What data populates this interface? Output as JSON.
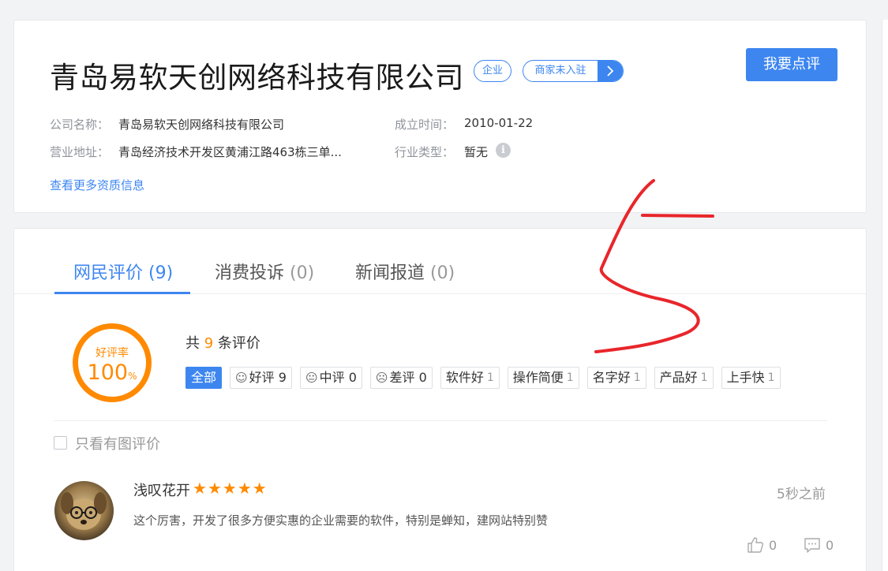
{
  "company": {
    "name": "青岛易软天创网络科技有限公司",
    "tag_enterprise": "企业",
    "tag_merchant": "商家未入驻",
    "review_button": "我要点评",
    "fields": {
      "name_label": "公司名称：",
      "name_value": "青岛易软天创网络科技有限公司",
      "founded_label": "成立时间：",
      "founded_value": "2010-01-22",
      "address_label": "营业地址：",
      "address_value": "青岛经济技术开发区黄浦江路463栋三单...",
      "industry_label": "行业类型：",
      "industry_value": "暂无"
    },
    "more_link": "查看更多资质信息"
  },
  "tabs": [
    {
      "label": "网民评价",
      "count": "(9)"
    },
    {
      "label": "消费投诉",
      "count": "(0)"
    },
    {
      "label": "新闻报道",
      "count": "(0)"
    }
  ],
  "summary": {
    "ring_label": "好评率",
    "ring_value": "100",
    "ring_unit": "%",
    "total_prefix": "共",
    "total_count": "9",
    "total_suffix": "条评价"
  },
  "filters": {
    "all": "全部",
    "good": {
      "label": "好评",
      "count": "9"
    },
    "neutral": {
      "label": "中评",
      "count": "0"
    },
    "bad": {
      "label": "差评",
      "count": "0"
    },
    "tags": [
      {
        "label": "软件好",
        "count": "1"
      },
      {
        "label": "操作简便",
        "count": "1"
      },
      {
        "label": "名字好",
        "count": "1"
      },
      {
        "label": "产品好",
        "count": "1"
      },
      {
        "label": "上手快",
        "count": "1"
      }
    ]
  },
  "image_only_label": "只看有图评价",
  "review": {
    "user": "浅叹花开",
    "rating": 5,
    "time": "5秒之前",
    "text": "这个厉害，开发了很多方便实惠的企业需要的软件，特别是蝉知，建网站特别赞",
    "likes": "0",
    "comments": "0"
  },
  "colors": {
    "accent": "#3d86f0",
    "orange": "#ff8a00",
    "annotation": "#e8262b"
  }
}
